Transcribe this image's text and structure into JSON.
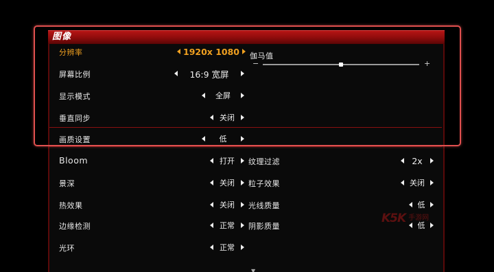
{
  "header": {
    "title": "图像"
  },
  "settings_left": [
    {
      "label": "分辨率",
      "value": "1920x 1080",
      "active": true
    },
    {
      "label": "屏幕比例",
      "value": "16:9 宽屏",
      "active": false
    },
    {
      "label": "显示模式",
      "value": "全屏",
      "active": false
    },
    {
      "label": "垂直同步",
      "value": "关闭",
      "active": false
    },
    {
      "label": "画质设置",
      "value": "低",
      "active": false
    },
    {
      "label": "Bloom",
      "value": "打开",
      "active": false
    },
    {
      "label": "景深",
      "value": "关闭",
      "active": false
    },
    {
      "label": "热效果",
      "value": "关闭",
      "active": false
    },
    {
      "label": "边缘检测",
      "value": "正常",
      "active": false
    },
    {
      "label": "光环",
      "value": "正常",
      "active": false
    }
  ],
  "gamma": {
    "label": "伽马值",
    "minus": "−",
    "plus": "+",
    "level": 0.5
  },
  "settings_right": [
    {
      "label": "纹理过滤",
      "value": "2x"
    },
    {
      "label": "粒子效果",
      "value": "关闭"
    },
    {
      "label": "光线质量",
      "value": "低"
    },
    {
      "label": "阴影质量",
      "value": "低"
    }
  ],
  "watermark": {
    "brand": "K5K",
    "sub": "手游网"
  },
  "colors": {
    "accent": "#f0a020",
    "header_red": "#b51414",
    "highlight": "#e0504f"
  }
}
